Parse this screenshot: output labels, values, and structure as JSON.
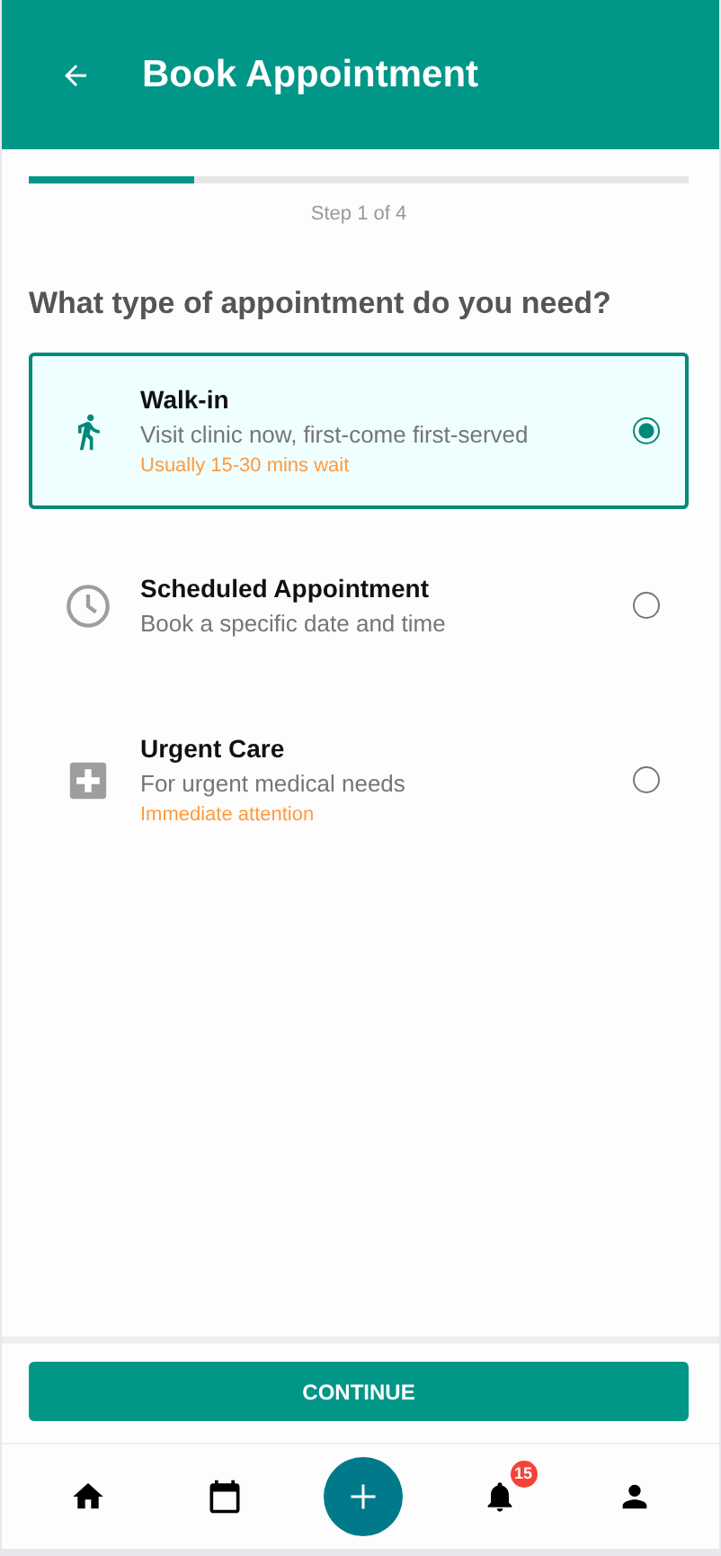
{
  "header": {
    "title": "Book Appointment"
  },
  "progress": {
    "level": 0.25,
    "label": "Step 1 of 4"
  },
  "question": "What type of appointment do you need?",
  "options": [
    {
      "kind": "walk",
      "title": "Walk-in",
      "description": "Visit clinic now, first-come first-served",
      "note": "Usually 15-30 mins wait",
      "selected": true
    },
    {
      "kind": "clock",
      "title": "Scheduled Appointment",
      "description": "Book a specific date and time",
      "selected": false
    },
    {
      "kind": "urgent",
      "title": "Urgent Care",
      "description": "For urgent medical needs",
      "note": "Immediate attention",
      "selected": false
    }
  ],
  "continue_button": "CONTINUE",
  "nav": [
    {
      "kind": "home"
    },
    {
      "kind": "calendar"
    },
    {
      "kind": "add"
    },
    {
      "kind": "bell",
      "badge": "15"
    },
    {
      "kind": "profile"
    }
  ]
}
